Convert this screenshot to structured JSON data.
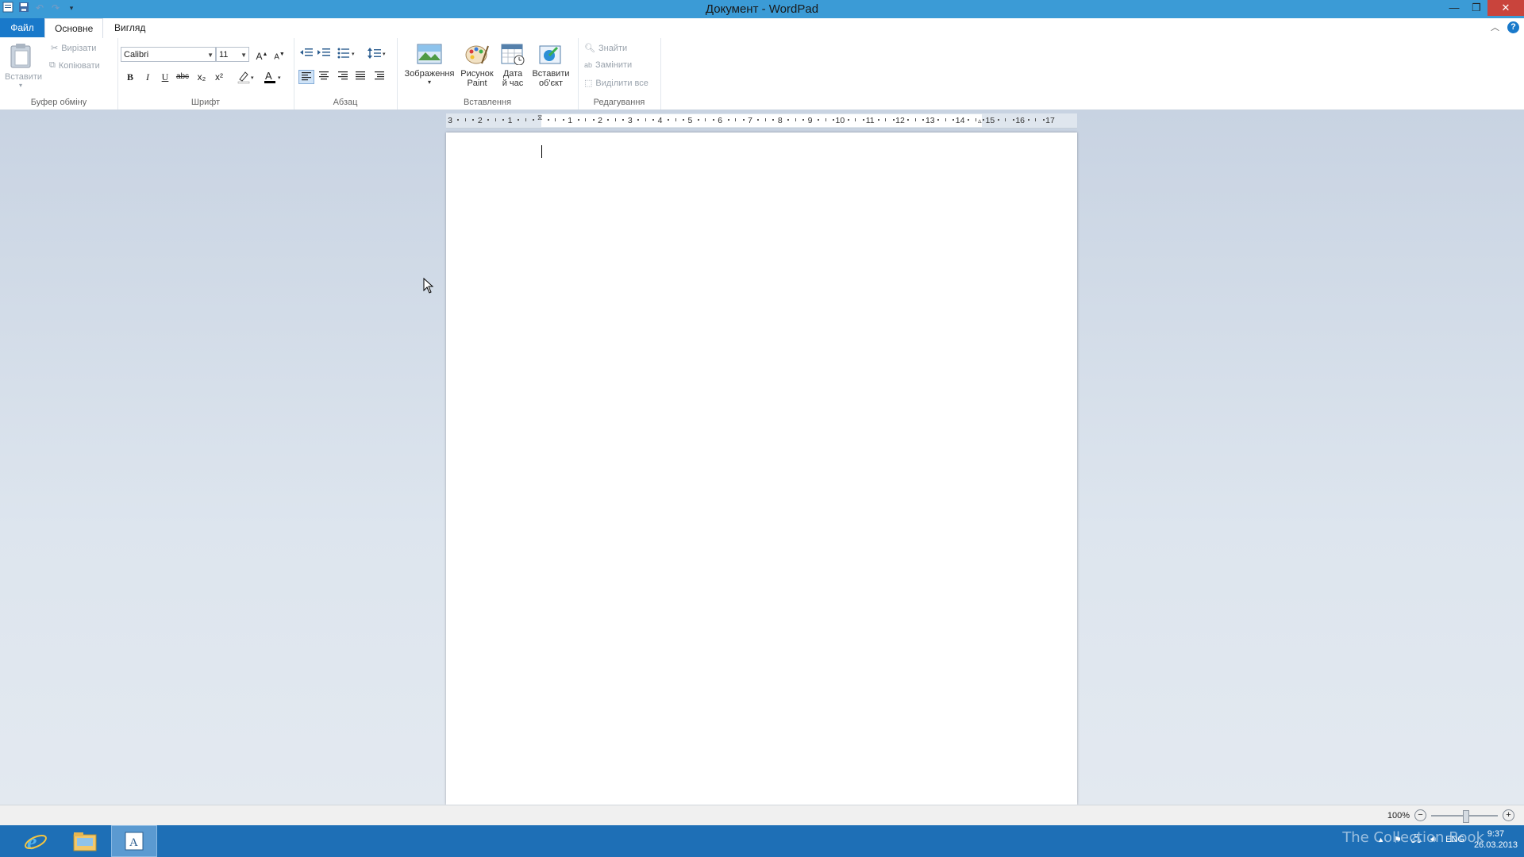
{
  "window": {
    "title": "Документ - WordPad",
    "min_icon": "minimize-icon",
    "max_icon": "restore-icon",
    "close_icon": "close-icon"
  },
  "qat": {
    "save_icon": "save-icon",
    "undo_icon": "undo-icon",
    "redo_icon": "redo-icon"
  },
  "tabs": {
    "file": "Файл",
    "home": "Основне",
    "view": "Вигляд"
  },
  "ribbon": {
    "clipboard": {
      "label": "Буфер обміну",
      "paste": "Вставити",
      "cut": "Вирізати",
      "copy": "Копіювати"
    },
    "font": {
      "label": "Шрифт",
      "family": "Calibri",
      "size": "11",
      "bold": "B",
      "italic": "I",
      "underline": "U",
      "strike": "abc",
      "sub": "x₂",
      "sup": "x²"
    },
    "paragraph": {
      "label": "Абзац"
    },
    "insert": {
      "label": "Вставлення",
      "picture": "Зображення",
      "paint_1": "Рисунок",
      "paint_2": "Paint",
      "datetime_1": "Дата",
      "datetime_2": "й час",
      "object_1": "Вставити",
      "object_2": "об'єкт"
    },
    "editing": {
      "label": "Редагування",
      "find": "Знайти",
      "replace": "Замінити",
      "select_all": "Виділити все"
    }
  },
  "ruler": {
    "ticks": [
      "3",
      "2",
      "1",
      "",
      "1",
      "2",
      "3",
      "4",
      "5",
      "6",
      "7",
      "8",
      "9",
      "10",
      "11",
      "12",
      "13",
      "14",
      "15",
      "16",
      "17"
    ]
  },
  "status": {
    "zoom": "100%"
  },
  "taskbar": {
    "time": "9:37",
    "date": "26.03.2013",
    "lang": "ENG",
    "watermark": "The Collection Book"
  },
  "colors": {
    "accent": "#1979ca",
    "titlebar": "#3b9bd6",
    "taskbar": "#1e6fb6",
    "close": "#c9443c"
  }
}
